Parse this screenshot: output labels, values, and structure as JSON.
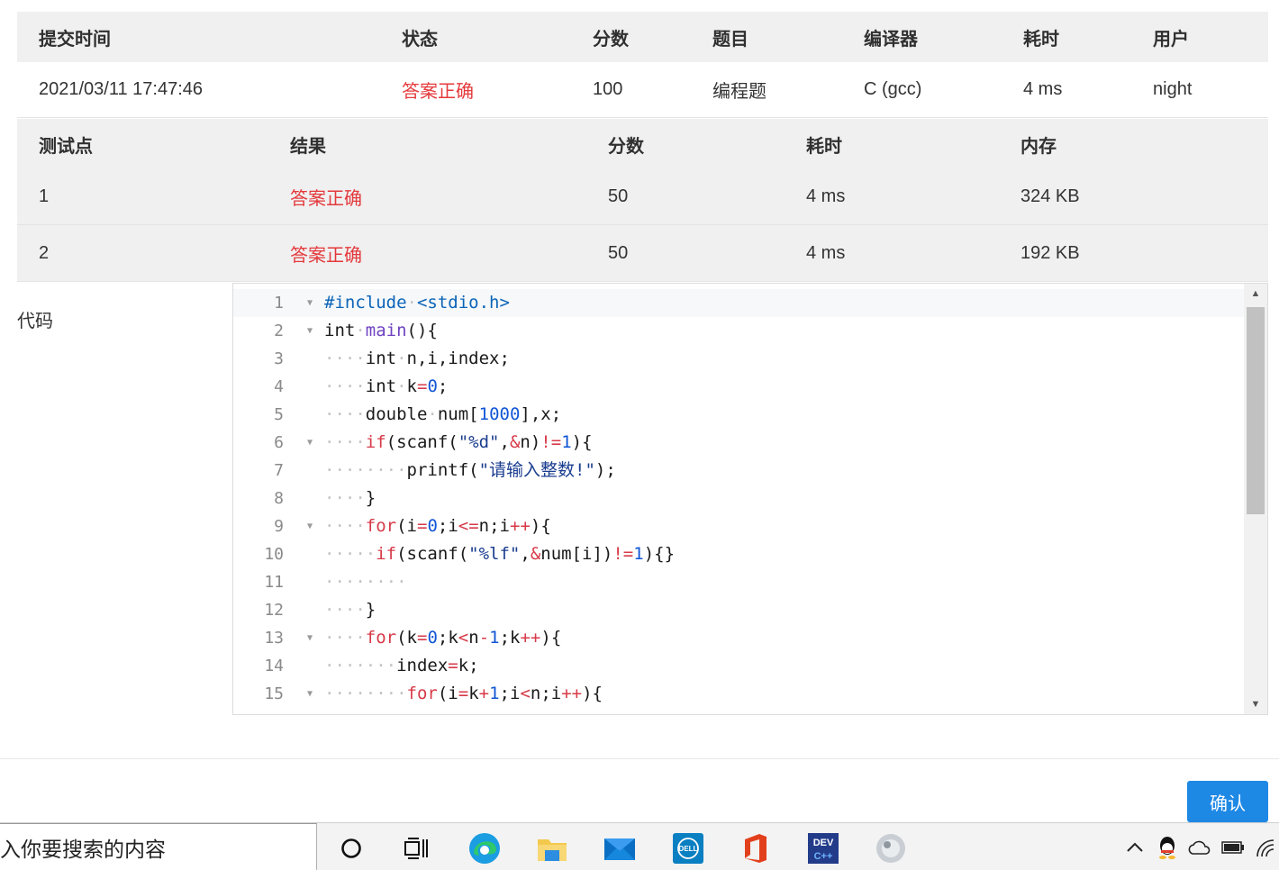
{
  "submission": {
    "headers": [
      "提交时间",
      "状态",
      "分数",
      "题目",
      "编译器",
      "耗时",
      "用户"
    ],
    "row": [
      "2021/03/11 17:47:46",
      "答案正确",
      "100",
      "编程题",
      "C (gcc)",
      "4 ms",
      "night"
    ]
  },
  "tests": {
    "headers": [
      "测试点",
      "结果",
      "分数",
      "耗时",
      "内存"
    ],
    "rows": [
      [
        "1",
        "答案正确",
        "50",
        "4 ms",
        "324 KB"
      ],
      [
        "2",
        "答案正确",
        "50",
        "4 ms",
        "192 KB"
      ]
    ]
  },
  "code": {
    "label": "代码",
    "lines": [
      {
        "n": "1",
        "fold": true,
        "text": "#include·<stdio.h>"
      },
      {
        "n": "2",
        "fold": true,
        "text": "int·main(){"
      },
      {
        "n": "3",
        "fold": false,
        "text": "····int·n,i,index;"
      },
      {
        "n": "4",
        "fold": false,
        "text": "····int·k=0;"
      },
      {
        "n": "5",
        "fold": false,
        "text": "····double·num[1000],x;"
      },
      {
        "n": "6",
        "fold": true,
        "text": "····if(scanf(\"%d\",&n)!=1){"
      },
      {
        "n": "7",
        "fold": false,
        "text": "········printf(\"请输入整数!\");"
      },
      {
        "n": "8",
        "fold": false,
        "text": "····}"
      },
      {
        "n": "9",
        "fold": true,
        "text": "····for(i=0;i<=n;i++){"
      },
      {
        "n": "10",
        "fold": false,
        "text": "·····if(scanf(\"%lf\",&num[i])!=1){}"
      },
      {
        "n": "11",
        "fold": false,
        "text": "········"
      },
      {
        "n": "12",
        "fold": false,
        "text": "····}"
      },
      {
        "n": "13",
        "fold": true,
        "text": "····for(k=0;k<n-1;k++){"
      },
      {
        "n": "14",
        "fold": false,
        "text": "·······index=k;"
      },
      {
        "n": "15",
        "fold": true,
        "text": "········for(i=k+1;i<n;i++){"
      }
    ]
  },
  "confirm_label": "确认",
  "taskbar": {
    "search_text": "入你要搜索的内容",
    "apps": [
      "cortana-icon",
      "task-view-icon",
      "edge-icon",
      "file-explorer-icon",
      "mail-icon",
      "dell-icon",
      "office-icon",
      "dev-cpp-icon",
      "app-icon"
    ]
  }
}
